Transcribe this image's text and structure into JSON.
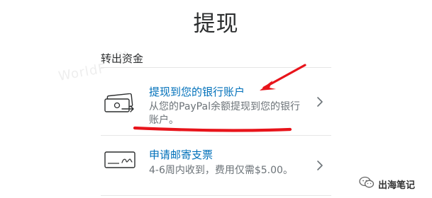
{
  "page": {
    "title": "提现",
    "section_label": "转出资金"
  },
  "options": {
    "bank": {
      "title": "提现到您的银行账户",
      "description": "从您的PayPal余额提现到您的银行账户。"
    },
    "check": {
      "title": "申请邮寄支票",
      "description": "4-6周内收到，费用仅需$5.00。"
    }
  },
  "watermark": {
    "brand": "出海笔记"
  },
  "colors": {
    "link_blue": "#0070ba",
    "annotation_red": "#e8141b",
    "muted_text": "#6c7378"
  },
  "icons": {
    "bank": "cash-transfer-icon",
    "check": "check-icon",
    "chevron": "chevron-right-icon",
    "brand": "wechat-icon"
  }
}
